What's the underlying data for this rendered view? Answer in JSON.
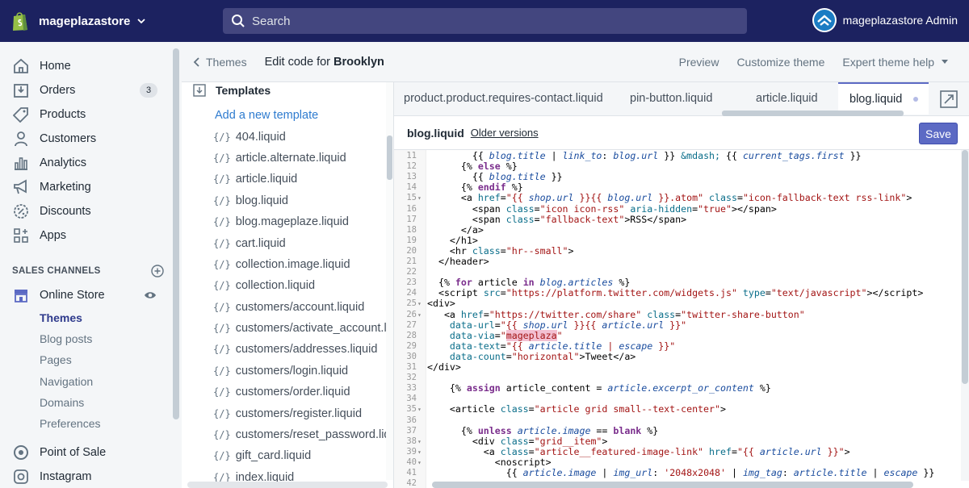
{
  "topbar": {
    "store_name": "mageplazastore",
    "search_placeholder": "Search",
    "admin_name": "mageplazastore Admin"
  },
  "nav": {
    "items": [
      {
        "label": "Home",
        "icon": "home-icon"
      },
      {
        "label": "Orders",
        "icon": "orders-icon",
        "badge": "3"
      },
      {
        "label": "Products",
        "icon": "tag-icon"
      },
      {
        "label": "Customers",
        "icon": "person-icon"
      },
      {
        "label": "Analytics",
        "icon": "bar-chart-icon"
      },
      {
        "label": "Marketing",
        "icon": "megaphone-icon"
      },
      {
        "label": "Discounts",
        "icon": "discount-icon"
      },
      {
        "label": "Apps",
        "icon": "apps-icon"
      }
    ],
    "sales_channels_label": "SALES CHANNELS",
    "online_store_label": "Online Store",
    "online_store_sub": [
      "Themes",
      "Blog posts",
      "Pages",
      "Navigation",
      "Domains",
      "Preferences"
    ],
    "point_of_sale_label": "Point of Sale",
    "instagram_label": "Instagram"
  },
  "header": {
    "back_label": "Themes",
    "edit_prefix": "Edit code for",
    "theme_name": "Brooklyn",
    "preview": "Preview",
    "customize": "Customize theme",
    "expert_help": "Expert theme help"
  },
  "tree": {
    "section": "Templates",
    "add_link": "Add a new template",
    "liquid_icon": "{/}",
    "files": [
      "404.liquid",
      "article.alternate.liquid",
      "article.liquid",
      "blog.liquid",
      "blog.mageplaze.liquid",
      "cart.liquid",
      "collection.image.liquid",
      "collection.liquid",
      "customers/account.liquid",
      "customers/activate_account.liquid",
      "customers/addresses.liquid",
      "customers/login.liquid",
      "customers/order.liquid",
      "customers/register.liquid",
      "customers/reset_password.liquid",
      "gift_card.liquid",
      "index.liquid"
    ]
  },
  "tabs": [
    {
      "label": "product.product.requires-contact.liquid",
      "dot": false
    },
    {
      "label": "pin-button.liquid",
      "dot": true
    },
    {
      "label": "article.liquid",
      "dot": false
    },
    {
      "label": "blog.liquid",
      "dot": true,
      "active": true
    }
  ],
  "editor": {
    "file_name": "blog.liquid",
    "older_versions": "Older versions",
    "save_label": "Save"
  }
}
